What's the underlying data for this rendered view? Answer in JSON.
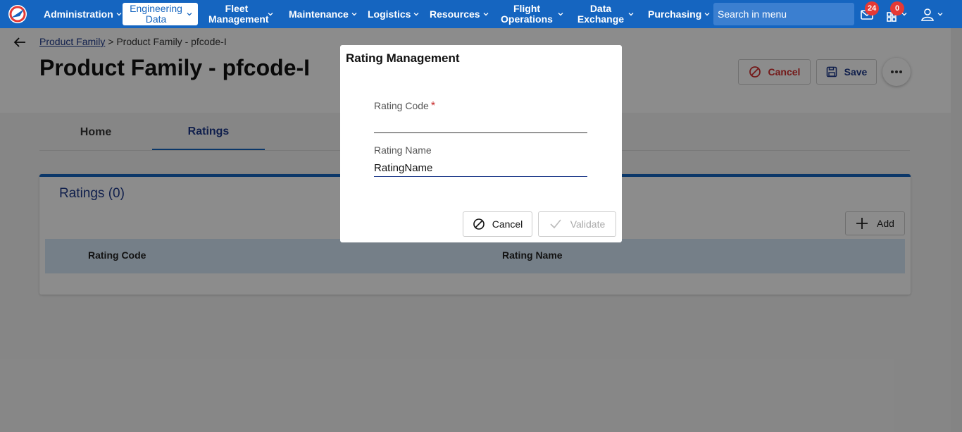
{
  "nav": {
    "items": [
      {
        "label": "Administration"
      },
      {
        "label": "Engineering Data"
      },
      {
        "label": "Fleet Management"
      },
      {
        "label": "Maintenance"
      },
      {
        "label": "Logistics"
      },
      {
        "label": "Resources"
      },
      {
        "label": "Flight Operations"
      },
      {
        "label": "Data Exchange"
      },
      {
        "label": "Purchasing"
      }
    ],
    "search_placeholder": "Search in menu",
    "mail_badge": "24",
    "cart_badge": "0",
    "colors": {
      "bar": "#1565c0",
      "badge": "#e53935"
    }
  },
  "page": {
    "breadcrumb_link": "Product Family",
    "breadcrumb_sep": " > ",
    "breadcrumb_current": "Product Family - pfcode-I",
    "title": "Product Family - pfcode-I",
    "cancel_label": "Cancel",
    "save_label": "Save",
    "tabs": [
      {
        "label": "Home"
      },
      {
        "label": "Ratings"
      }
    ],
    "card_title": "Ratings (0)",
    "add_label": "Add",
    "columns": [
      "Rating Code",
      "Rating Name"
    ]
  },
  "modal": {
    "title": "Rating Management",
    "code_label": "Rating Code",
    "required_mark": "*",
    "code_value": "",
    "name_label": "Rating Name",
    "name_value": "RatingName",
    "cancel_label": "Cancel",
    "validate_label": "Validate"
  }
}
